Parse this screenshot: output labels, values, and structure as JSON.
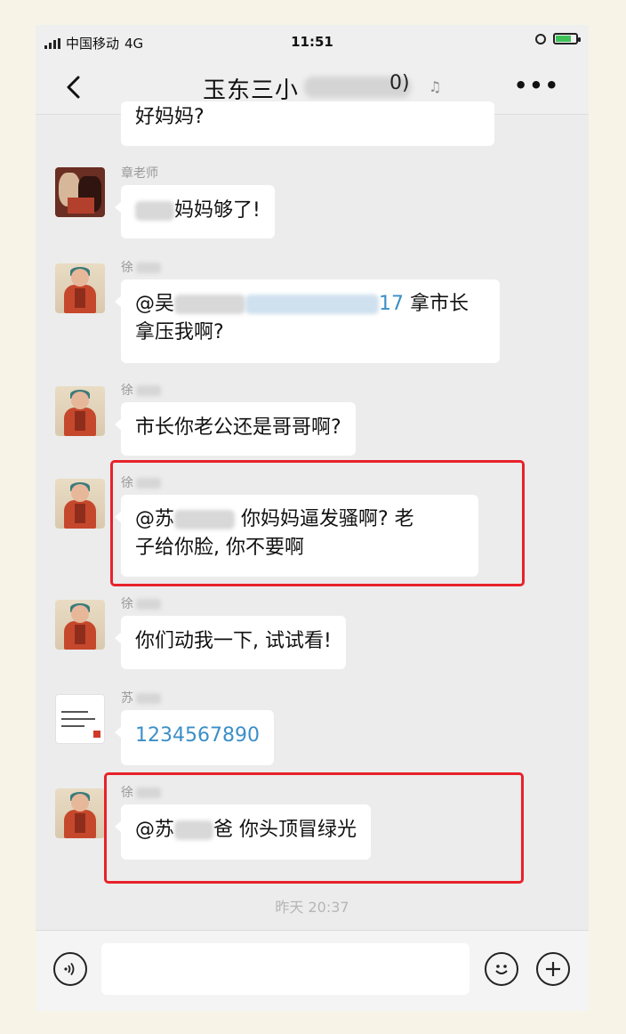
{
  "status_bar": {
    "carrier": "中国移动",
    "network": "4G",
    "time": "11:51"
  },
  "header": {
    "title": "玉东三小",
    "title_suffix": "0)"
  },
  "messages": [
    {
      "name": "",
      "text": "好妈妈?"
    },
    {
      "name": "章老师",
      "text_suffix": "妈妈够了!"
    },
    {
      "name": "徐",
      "mention": "@吴",
      "mention_suffix": "17",
      "text_line1": "拿市长",
      "text_line2": "拿压我啊?"
    },
    {
      "name": "徐",
      "text": "市长你老公还是哥哥啊?"
    },
    {
      "name": "徐",
      "mention": "@苏",
      "text_line1": "你妈妈逼发骚啊? 老",
      "text_line2": "子给你脸, 你不要啊"
    },
    {
      "name": "徐",
      "text": "你们动我一下, 试试看!"
    },
    {
      "name": "苏",
      "text": "1234567890"
    },
    {
      "name": "徐",
      "mention": "@苏",
      "text": "爸 你头顶冒绿光"
    }
  ],
  "timestamp": "昨天 20:37",
  "input_bar": {
    "placeholder": ""
  },
  "colors": {
    "highlight_box": "#e8222a",
    "link": "#3c8fc7",
    "background": "#ececec"
  },
  "icons": [
    "back-arrow-icon",
    "mute-bell-icon",
    "more-icon",
    "voice-icon",
    "emoji-icon",
    "plus-icon"
  ]
}
